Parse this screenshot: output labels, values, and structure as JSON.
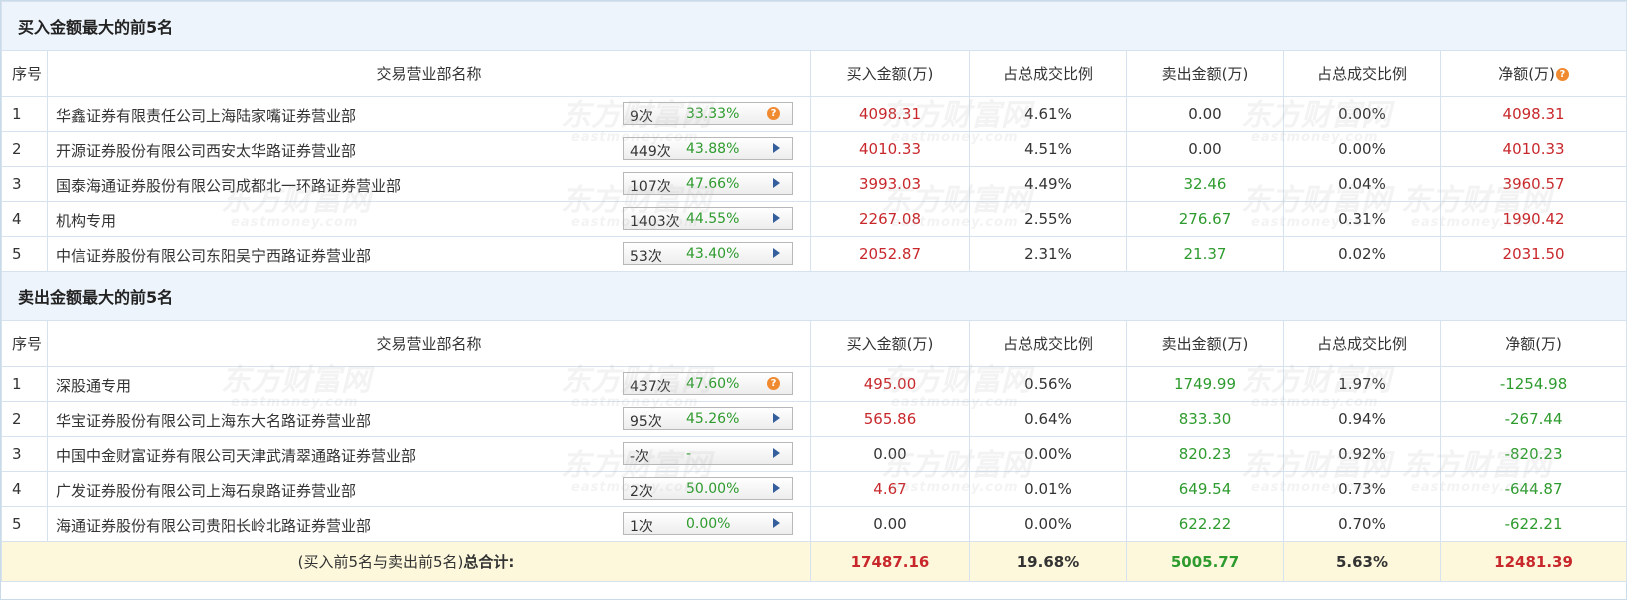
{
  "buy_section": {
    "title": "买入金额最大的前5名",
    "headers": [
      "序号",
      "交易营业部名称",
      "买入金额(万)",
      "占总成交比例",
      "卖出金额(万)",
      "占总成交比例",
      "净额(万)"
    ],
    "help_icon": "question-circle-icon",
    "rows": [
      {
        "seq": "1",
        "name": "华鑫证券有限责任公司上海陆家嘴证券营业部",
        "count": "9次",
        "pct": "33.33%",
        "icon": "question-circle-icon",
        "buy": "4098.31",
        "buy_ratio": "4.61%",
        "sell": "0.00",
        "sell_ratio": "0.00%",
        "net": "4098.31"
      },
      {
        "seq": "2",
        "name": "开源证券股份有限公司西安太华路证券营业部",
        "count": "449次",
        "pct": "43.88%",
        "icon": "play-arrow-icon",
        "buy": "4010.33",
        "buy_ratio": "4.51%",
        "sell": "0.00",
        "sell_ratio": "0.00%",
        "net": "4010.33"
      },
      {
        "seq": "3",
        "name": "国泰海通证券股份有限公司成都北一环路证券营业部",
        "count": "107次",
        "pct": "47.66%",
        "icon": "play-arrow-icon",
        "buy": "3993.03",
        "buy_ratio": "4.49%",
        "sell": "32.46",
        "sell_ratio": "0.04%",
        "net": "3960.57"
      },
      {
        "seq": "4",
        "name": "机构专用",
        "count": "1403次",
        "pct": "44.55%",
        "icon": "play-arrow-icon",
        "buy": "2267.08",
        "buy_ratio": "2.55%",
        "sell": "276.67",
        "sell_ratio": "0.31%",
        "net": "1990.42"
      },
      {
        "seq": "5",
        "name": "中信证券股份有限公司东阳吴宁西路证券营业部",
        "count": "53次",
        "pct": "43.40%",
        "icon": "play-arrow-icon",
        "buy": "2052.87",
        "buy_ratio": "2.31%",
        "sell": "21.37",
        "sell_ratio": "0.02%",
        "net": "2031.50"
      }
    ]
  },
  "sell_section": {
    "title": "卖出金额最大的前5名",
    "headers": [
      "序号",
      "交易营业部名称",
      "买入金额(万)",
      "占总成交比例",
      "卖出金额(万)",
      "占总成交比例",
      "净额(万)"
    ],
    "rows": [
      {
        "seq": "1",
        "name": "深股通专用",
        "count": "437次",
        "pct": "47.60%",
        "icon": "question-circle-icon",
        "buy": "495.00",
        "buy_ratio": "0.56%",
        "sell": "1749.99",
        "sell_ratio": "1.97%",
        "net": "-1254.98"
      },
      {
        "seq": "2",
        "name": "华宝证券股份有限公司上海东大名路证券营业部",
        "count": "95次",
        "pct": "45.26%",
        "icon": "play-arrow-icon",
        "buy": "565.86",
        "buy_ratio": "0.64%",
        "sell": "833.30",
        "sell_ratio": "0.94%",
        "net": "-267.44"
      },
      {
        "seq": "3",
        "name": "中国中金财富证券有限公司天津武清翠通路证券营业部",
        "count": "-次",
        "pct": "-",
        "icon": "play-arrow-icon",
        "buy": "0.00",
        "buy_ratio": "0.00%",
        "sell": "820.23",
        "sell_ratio": "0.92%",
        "net": "-820.23"
      },
      {
        "seq": "4",
        "name": "广发证券股份有限公司上海石泉路证券营业部",
        "count": "2次",
        "pct": "50.00%",
        "icon": "play-arrow-icon",
        "buy": "4.67",
        "buy_ratio": "0.01%",
        "sell": "649.54",
        "sell_ratio": "0.73%",
        "net": "-644.87"
      },
      {
        "seq": "5",
        "name": "海通证券股份有限公司贵阳长岭北路证券营业部",
        "count": "1次",
        "pct": "0.00%",
        "icon": "play-arrow-icon",
        "buy": "0.00",
        "buy_ratio": "0.00%",
        "sell": "622.22",
        "sell_ratio": "0.70%",
        "net": "-622.21"
      }
    ]
  },
  "total": {
    "label_prefix": "(买入前5名与卖出前5名)",
    "label_bold": "总合计:",
    "buy": "17487.16",
    "buy_ratio": "19.68%",
    "sell": "5005.77",
    "sell_ratio": "5.63%",
    "net": "12481.39"
  },
  "watermark": {
    "text": "东方财富网",
    "subtext": "eastmoney.com"
  },
  "colors": {
    "up": "#c8282c",
    "down": "#2e9b2e",
    "neutral": "#333333",
    "section_bg": "#edf4fb",
    "total_bg": "#fdf8dc"
  }
}
